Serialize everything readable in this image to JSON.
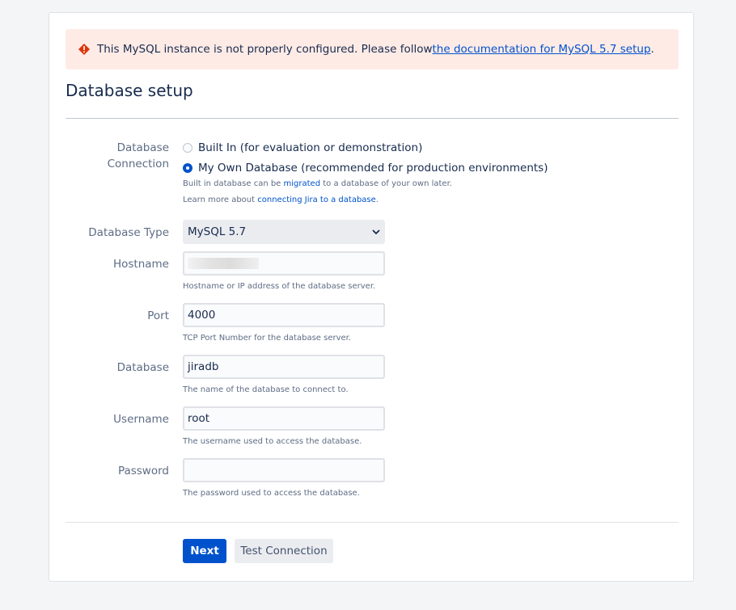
{
  "banner": {
    "message": "This MySQL instance is not properly configured. Please follow ",
    "link_text": "the documentation for MySQL 5.7 setup",
    "suffix": ".",
    "icon": "error-icon",
    "color": "#de350b",
    "background": "#ffebe6"
  },
  "page_title": "Database setup",
  "db_connection": {
    "label_line1": "Database",
    "label_line2": "Connection",
    "options": [
      {
        "label": "Built In (for evaluation or demonstration)",
        "checked": false
      },
      {
        "label": "My Own Database (recommended for production environments)",
        "checked": true
      }
    ],
    "help1_prefix": "Built in database can be ",
    "help1_link": "migrated",
    "help1_suffix": " to a database of your own later.",
    "help2_prefix": "Learn more about ",
    "help2_link": "connecting Jira to a database",
    "help2_suffix": "."
  },
  "database_type": {
    "label": "Database Type",
    "selected": "MySQL 5.7",
    "icon": "chevron-down-icon"
  },
  "hostname": {
    "label": "Hostname",
    "value": "",
    "help": "Hostname or IP address of the database server."
  },
  "port": {
    "label": "Port",
    "value": "4000",
    "help": "TCP Port Number for the database server."
  },
  "database": {
    "label": "Database",
    "value": "jiradb",
    "help": "The name of the database to connect to."
  },
  "username": {
    "label": "Username",
    "value": "root",
    "help": "The username used to access the database."
  },
  "password": {
    "label": "Password",
    "value": "",
    "help": "The password used to access the database."
  },
  "buttons": {
    "next": "Next",
    "test_connection": "Test Connection"
  },
  "colors": {
    "primary": "#0052cc",
    "text": "#172b4d",
    "muted": "#5e6c84"
  }
}
